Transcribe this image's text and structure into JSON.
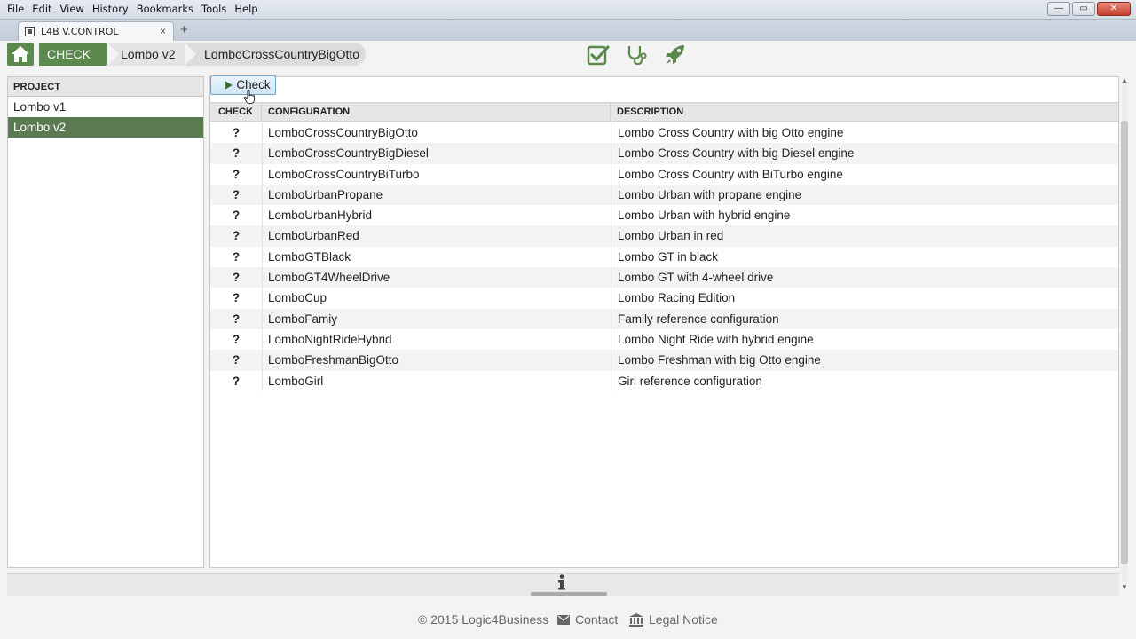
{
  "menu": [
    "File",
    "Edit",
    "View",
    "History",
    "Bookmarks",
    "Tools",
    "Help"
  ],
  "window_controls": {
    "minimize": "—",
    "maximize": "▭",
    "close": "✕"
  },
  "browser_tab": {
    "title": "L4B V.CONTROL",
    "close": "×",
    "new_tab": "+"
  },
  "breadcrumb": {
    "check": "CHECK",
    "project": "Lombo v2",
    "configuration": "LomboCrossCountryBigOtto"
  },
  "nav_icons": [
    "check-square-icon",
    "stethoscope-icon",
    "rocket-icon"
  ],
  "project_panel": {
    "header": "PROJECT",
    "items": [
      {
        "label": "Lombo v1",
        "selected": false
      },
      {
        "label": "Lombo v2",
        "selected": true
      }
    ]
  },
  "check_button": {
    "label": "Check"
  },
  "table": {
    "columns": [
      "CHECK",
      "CONFIGURATION",
      "DESCRIPTION"
    ],
    "rows": [
      {
        "check": "?",
        "configuration": "LomboCrossCountryBigOtto",
        "description": "Lombo Cross Country with big Otto engine"
      },
      {
        "check": "?",
        "configuration": "LomboCrossCountryBigDiesel",
        "description": "Lombo Cross Country with big Diesel engine"
      },
      {
        "check": "?",
        "configuration": "LomboCrossCountryBiTurbo",
        "description": "Lombo Cross Country with BiTurbo engine"
      },
      {
        "check": "?",
        "configuration": "LomboUrbanPropane",
        "description": "Lombo Urban with propane engine"
      },
      {
        "check": "?",
        "configuration": "LomboUrbanHybrid",
        "description": "Lombo Urban with hybrid engine"
      },
      {
        "check": "?",
        "configuration": "LomboUrbanRed",
        "description": "Lombo Urban in red"
      },
      {
        "check": "?",
        "configuration": "LomboGTBlack",
        "description": "Lombo GT in black"
      },
      {
        "check": "?",
        "configuration": "LomboGT4WheelDrive",
        "description": "Lombo GT with 4-wheel drive"
      },
      {
        "check": "?",
        "configuration": "LomboCup",
        "description": "Lombo Racing Edition"
      },
      {
        "check": "?",
        "configuration": "LomboFamiy",
        "description": "Family reference configuration"
      },
      {
        "check": "?",
        "configuration": "LomboNightRideHybrid",
        "description": "Lombo Night Ride with hybrid engine"
      },
      {
        "check": "?",
        "configuration": "LomboFreshmanBigOtto",
        "description": "Lombo Freshman with big Otto engine"
      },
      {
        "check": "?",
        "configuration": "LomboGirl",
        "description": "Girl reference configuration"
      }
    ]
  },
  "footer": {
    "copyright": "© 2015 Logic4Business",
    "contact": "Contact",
    "legal": "Legal Notice"
  },
  "colors": {
    "accent_green": "#5c8a4e",
    "selected_row": "#5c7a52"
  }
}
